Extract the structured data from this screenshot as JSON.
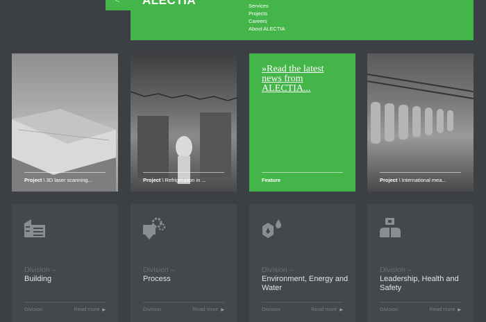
{
  "header": {
    "logo_text": "ALECTIA",
    "back_arrow": "<",
    "menu": [
      "Services",
      "Projects",
      "Careers",
      "About ALECTIA"
    ]
  },
  "tiles": [
    {
      "kind": "Project",
      "sep": "\\",
      "text": "3D laser scanning..."
    },
    {
      "kind": "Project",
      "sep": "\\",
      "text": "Refrigeration in ..."
    },
    {
      "kind": "Feature",
      "headline": "»Read the latest news from ALECTIA..."
    },
    {
      "kind": "Project",
      "sep": "\\",
      "text": "International mea..."
    }
  ],
  "divisions": [
    {
      "kicker": "Division –",
      "title": "Building",
      "footer": "Division",
      "more": "Read more",
      "icon": "building-icon"
    },
    {
      "kicker": "Division –",
      "title": "Process",
      "footer": "Division",
      "more": "Read more",
      "icon": "process-gears-icon"
    },
    {
      "kicker": "Division –",
      "title": "Environment, Energy and Water",
      "footer": "Division",
      "more": "Read more",
      "icon": "environment-drops-icon"
    },
    {
      "kicker": "Division –",
      "title": "Leadership, Health and Safety",
      "footer": "Division",
      "more": "Read more",
      "icon": "leadership-people-icon"
    }
  ],
  "colors": {
    "brand_green": "#44b549",
    "background": "#3c3f44",
    "card": "#44474c",
    "icon_grey": "#8a8d92"
  }
}
